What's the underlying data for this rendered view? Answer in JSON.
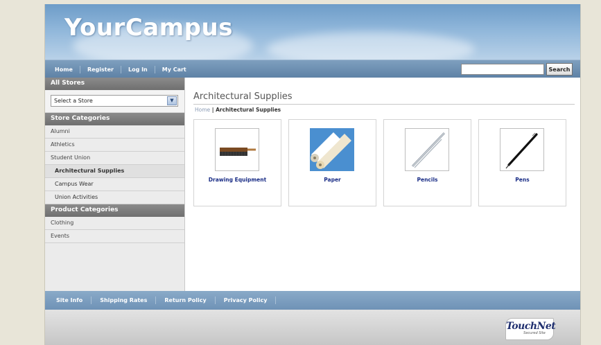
{
  "site": {
    "logo": "YourCampus"
  },
  "nav": {
    "items": [
      "Home",
      "Register",
      "Log In",
      "My Cart"
    ]
  },
  "search": {
    "placeholder": "",
    "button_label": "Search"
  },
  "sidebar": {
    "all_stores_heading": "All Stores",
    "store_select_value": "Select a Store",
    "store_categories_heading": "Store Categories",
    "store_categories": [
      {
        "label": "Alumni",
        "sub": false,
        "active": false
      },
      {
        "label": "Athletics",
        "sub": false,
        "active": false
      },
      {
        "label": "Student Union",
        "sub": false,
        "active": false
      },
      {
        "label": "Architectural Supplies",
        "sub": true,
        "active": true
      },
      {
        "label": "Campus Wear",
        "sub": true,
        "active": false
      },
      {
        "label": "Union Activities",
        "sub": true,
        "active": false
      }
    ],
    "product_categories_heading": "Product Categories",
    "product_categories": [
      "Clothing",
      "Events"
    ]
  },
  "main": {
    "title": "Architectural Supplies",
    "breadcrumb": {
      "home": "Home",
      "separator": " | ",
      "current": "Architectural Supplies"
    },
    "products": [
      {
        "label": "Drawing Equipment",
        "icon": "brush-icon"
      },
      {
        "label": "Paper",
        "icon": "paper-rolls-icon"
      },
      {
        "label": "Pencils",
        "icon": "pencil-icon"
      },
      {
        "label": "Pens",
        "icon": "pen-icon"
      }
    ]
  },
  "footer": {
    "links": [
      "Site Info",
      "Shipping Rates",
      "Return Policy",
      "Privacy Policy"
    ]
  },
  "badge": {
    "brand": "TouchNet",
    "tagline": "Secured Site"
  },
  "colors": {
    "link_blue": "#1a2d86",
    "nav_blue": "#5f82a6"
  }
}
